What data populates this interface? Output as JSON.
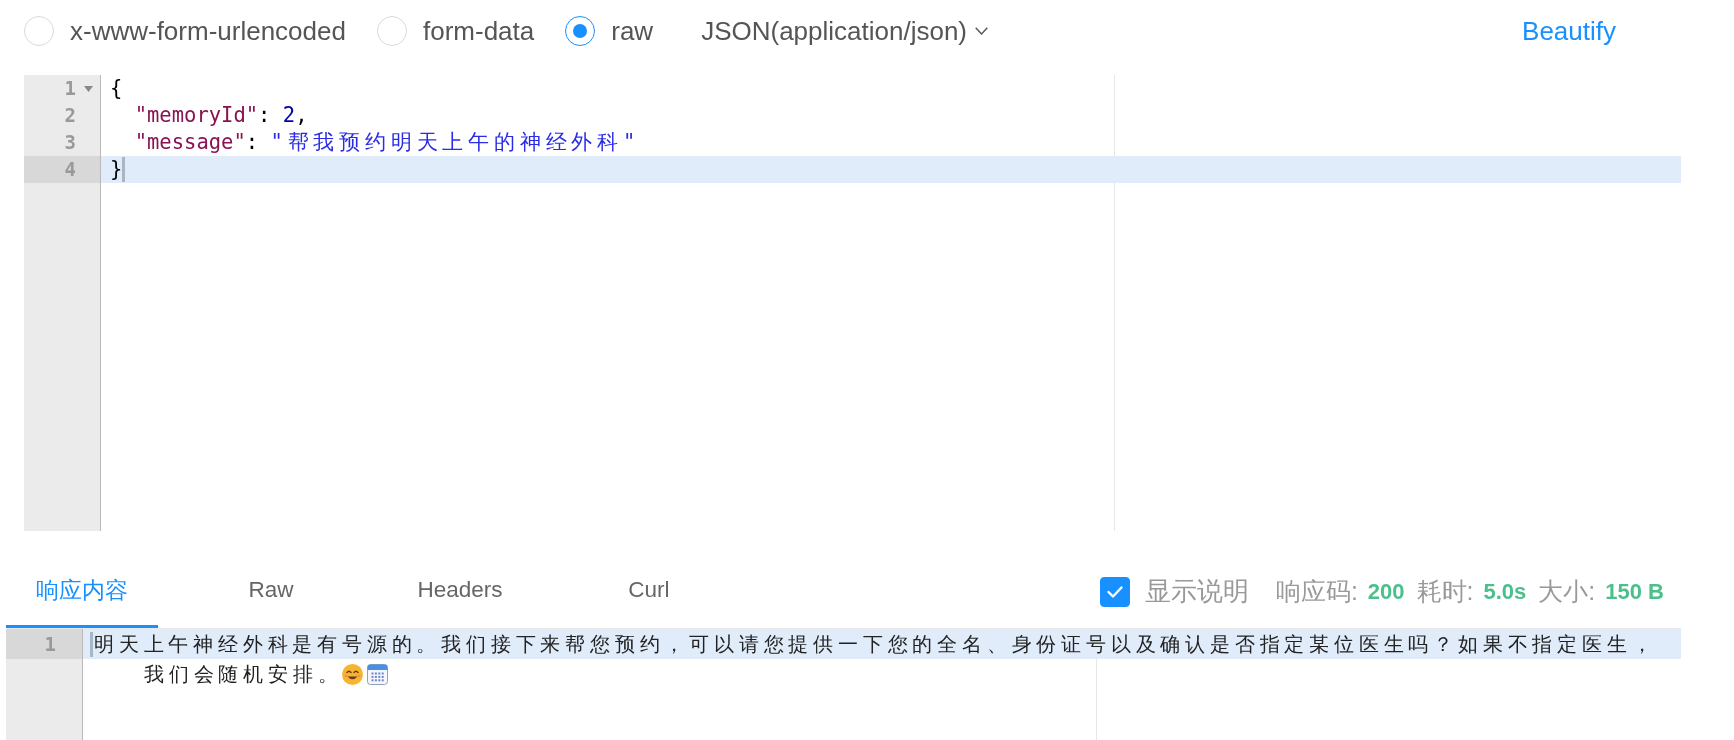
{
  "body_types": [
    {
      "label": "x-www-form-urlencoded",
      "selected": false
    },
    {
      "label": "form-data",
      "selected": false
    },
    {
      "label": "raw",
      "selected": true
    }
  ],
  "content_type": {
    "value": "JSON(application/json)"
  },
  "beautify": {
    "label": "Beautify"
  },
  "request_editor": {
    "lines": [
      {
        "number": "1",
        "fold": {
          "expanded": true
        },
        "active": false,
        "tokens": [
          {
            "kind": "punct",
            "text": "{"
          }
        ],
        "children": [
          {
            "number": "2",
            "active": false,
            "tokens": [
              {
                "kind": "key",
                "text": "\"memoryId\""
              },
              {
                "kind": "punct",
                "text": ": "
              },
              {
                "kind": "number",
                "text": "2"
              },
              {
                "kind": "punct",
                "text": ","
              }
            ]
          },
          {
            "number": "3",
            "active": false,
            "tokens": [
              {
                "kind": "key",
                "text": "\"message\""
              },
              {
                "kind": "punct",
                "text": ": "
              },
              {
                "kind": "string",
                "text": "\"帮我预约明天上午的神经外科\""
              }
            ]
          }
        ]
      },
      {
        "number": "4",
        "active": true,
        "tokens": [
          {
            "kind": "punct",
            "text": "}"
          },
          {
            "kind": "cursor"
          }
        ]
      }
    ]
  },
  "response": {
    "tabs": [
      {
        "label": "响应内容",
        "selected": true
      },
      {
        "label": "Raw",
        "selected": false
      },
      {
        "label": "Headers",
        "selected": false
      },
      {
        "label": "Curl",
        "selected": false
      }
    ],
    "show_description": {
      "label": "显示说明",
      "checked": true
    },
    "stats": [
      {
        "label": "响应码:",
        "value": "200"
      },
      {
        "label": "耗时:",
        "value": "5.0s"
      },
      {
        "label": "大小:",
        "value": "150 B"
      }
    ],
    "editor": {
      "lines": [
        {
          "number": "1",
          "active": true,
          "rows": [
            {
              "tokens": [
                {
                  "kind": "cursor"
                },
                {
                  "kind": "text",
                  "text": "明天上午神经外科是有号源的。我们接下来帮您预约，可以请您提供一下您的全名、身份证号以及确认是否指定某位医生吗？如果不指定医生，"
                }
              ]
            },
            {
              "tokens": [
                {
                  "kind": "text",
                  "text": "我们会随机安排。"
                }
              ]
            }
          ]
        }
      ]
    }
  }
}
